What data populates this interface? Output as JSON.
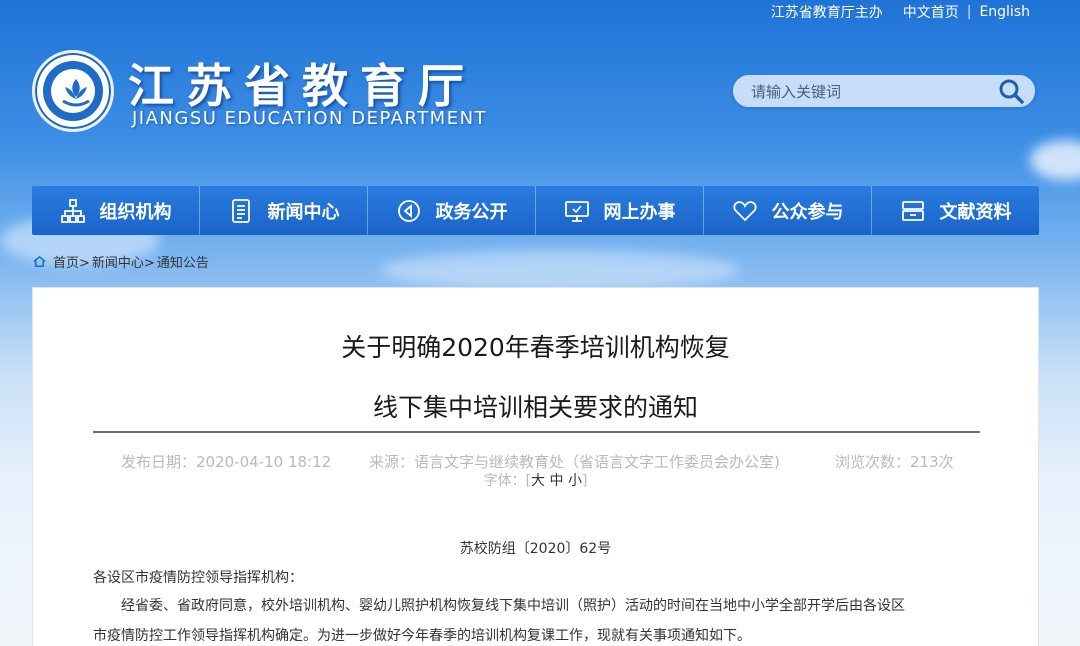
{
  "top_links": {
    "sponsor": "江苏省教育厅主办",
    "chinese_home": "中文首页",
    "separator": "|",
    "english": "English"
  },
  "logo": {
    "title": "江苏省教育厅",
    "subtitle": "JIANGSU EDUCATION DEPARTMENT"
  },
  "search": {
    "placeholder": "请输入关键词",
    "icon": "search-icon"
  },
  "nav": {
    "items": [
      {
        "label": "组织机构",
        "icon": "org-chart-icon"
      },
      {
        "label": "新闻中心",
        "icon": "document-icon"
      },
      {
        "label": "政务公开",
        "icon": "sound-icon"
      },
      {
        "label": "网上办事",
        "icon": "monitor-icon"
      },
      {
        "label": "公众参与",
        "icon": "heart-icon"
      },
      {
        "label": "文献资料",
        "icon": "archive-icon"
      }
    ],
    "accent_color": "#1f6ed4"
  },
  "breadcrumb": {
    "home": "首页>",
    "news": "新闻中心>",
    "current": "通知公告"
  },
  "article": {
    "title_line1": "关于明确2020年春季培训机构恢复",
    "title_line2": "线下集中培训相关要求的通知",
    "publish_date": "发布日期：2020-04-10 18:12",
    "source": "来源：语言文字与继续教育处（省语言文字工作委员会办公室)",
    "views": "浏览次数：213次",
    "font_label": "字体：",
    "font_open": "[",
    "font_large": "大",
    "font_medium": "中",
    "font_small": "小",
    "font_close": "]",
    "doc_number": "苏校防组〔2020〕62号",
    "addressee": "各设区市疫情防控领导指挥机构：",
    "paragraph1_line1": "经省委、省政府同意，校外培训机构、婴幼儿照护机构恢复线下集中培训（照护）活动的时间在当地中小学全部开学后由各设区",
    "paragraph1_line2": "市疫情防控工作领导指挥机构确定。为进一步做好今年春季的培训机构复课工作，现就有关事项通知如下。"
  }
}
